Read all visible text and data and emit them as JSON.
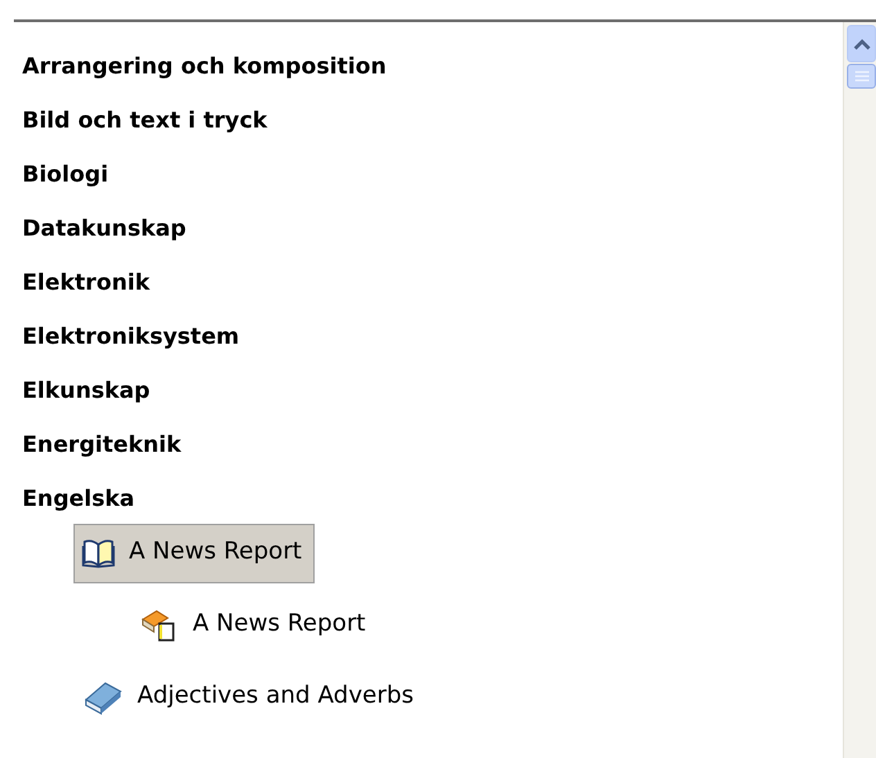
{
  "tree": [
    {
      "label": "Arrangering och komposition"
    },
    {
      "label": "Bild och text i tryck"
    },
    {
      "label": "Biologi"
    },
    {
      "label": "Datakunskap"
    },
    {
      "label": "Elektronik"
    },
    {
      "label": "Elektroniksystem"
    },
    {
      "label": "Elkunskap"
    },
    {
      "label": "Energiteknik"
    },
    {
      "label": "Engelska",
      "children": [
        {
          "label": "A News Report",
          "kind": "open-book",
          "selected": true,
          "children": [
            {
              "label": "A News Report",
              "kind": "book-doc",
              "selected": false
            }
          ]
        },
        {
          "label": "Adjectives and Adverbs",
          "kind": "closed-book",
          "selected": false
        }
      ]
    }
  ]
}
